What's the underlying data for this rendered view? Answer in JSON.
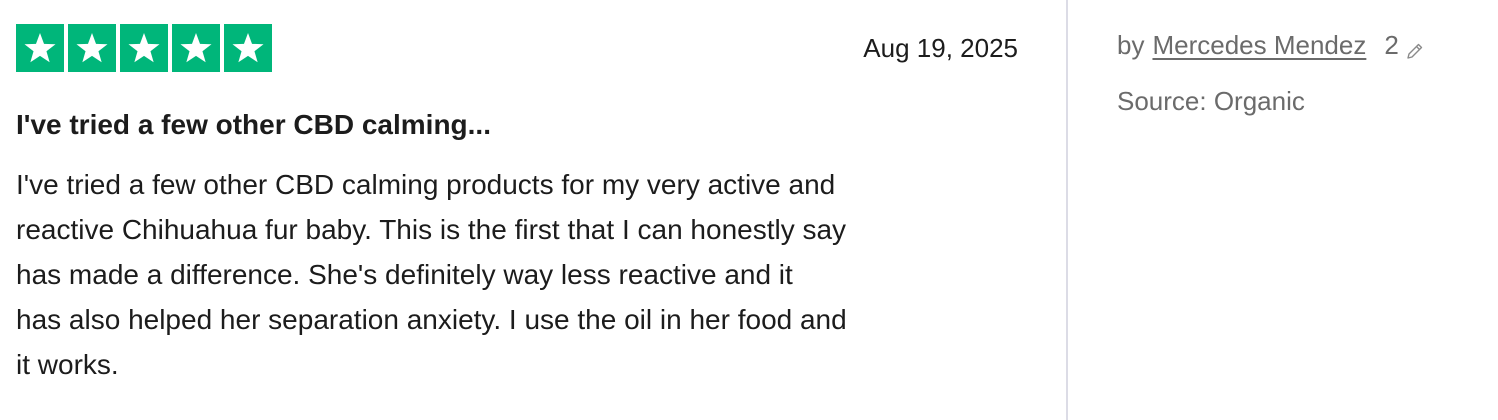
{
  "review": {
    "rating": 5,
    "rating_max": 5,
    "star_color": "#00b67a",
    "date": "Aug 19, 2025",
    "title": "I've tried a few other CBD calming...",
    "body_lines": [
      "I've tried a few other CBD calming products for my very active and",
      "reactive Chihuahua fur baby. This is the first that I can honestly say",
      "has made a difference. She's definitely way less reactive and it",
      "has also helped her separation anxiety. I use the oil in her food and",
      "it works."
    ]
  },
  "sidebar": {
    "by_label": "by",
    "author_name": "Mercedes Mendez",
    "review_count": "2",
    "count_icon": "pencil-icon",
    "source_text": "Source: Organic"
  }
}
